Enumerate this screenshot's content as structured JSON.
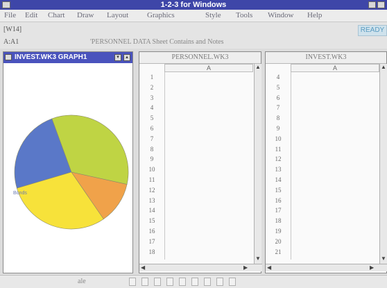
{
  "app": {
    "title": "1-2-3 for Windows"
  },
  "menu": [
    "File",
    "Edit",
    "Chart",
    "Draw",
    "Layout",
    "Graphics",
    "Style",
    "Tools",
    "Window",
    "Help"
  ],
  "format_indicator": "[W14]",
  "mode_indicator": "READY",
  "cell_address": "A:A1",
  "cell_contents": "'PERSONNEL DATA Sheet Contains and Notes",
  "graph_window": {
    "title": "INVEST.WK3 GRAPH1",
    "slice_label": "Bonds"
  },
  "chart_data": {
    "type": "pie",
    "slices": [
      {
        "value": 34,
        "color": "#bfd444"
      },
      {
        "value": 12,
        "color": "#f0a24a"
      },
      {
        "value": 30,
        "color": "#f7e23a"
      },
      {
        "value": 24,
        "color": "#5a78c8"
      }
    ]
  },
  "personnel_sheet": {
    "title": "PERSONNEL.WK3",
    "column": "A",
    "rows": [
      "1",
      "2",
      "3",
      "4",
      "5",
      "6",
      "7",
      "8",
      "9",
      "10",
      "11",
      "12",
      "13",
      "14",
      "15",
      "16",
      "17",
      "18"
    ]
  },
  "invest_sheet": {
    "title": "INVEST.WK3",
    "column": "A",
    "rows": [
      "4",
      "5",
      "6",
      "7",
      "8",
      "9",
      "10",
      "11",
      "12",
      "13",
      "14",
      "15",
      "16",
      "17",
      "18",
      "19",
      "20",
      "21"
    ]
  },
  "status_bar": {
    "text": "ale"
  },
  "colors": {
    "titlebar": "#3e46a8",
    "graph_caption": "#4a53bd",
    "ready_bg": "#cfe2ec"
  }
}
